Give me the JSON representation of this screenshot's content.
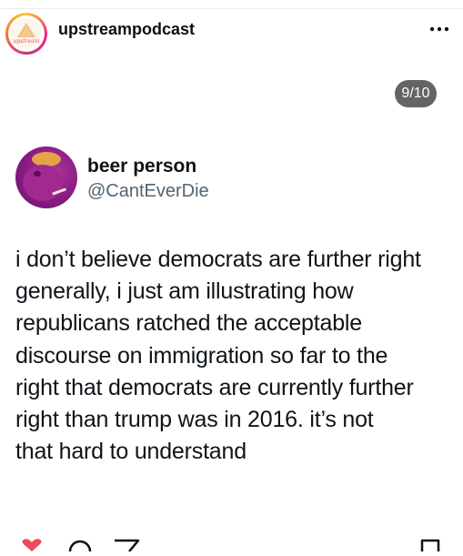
{
  "header": {
    "username": "upstreampodcast",
    "logo_text": "upstream",
    "more_icon": "more-horizontal-icon"
  },
  "carousel": {
    "counter": "9/10"
  },
  "tweet": {
    "display_name": "beer person",
    "handle": "@CantEverDie",
    "lines": [
      "i don’t believe democrats are further right",
      "generally, i just am illustrating how",
      "republicans ratched the acceptable",
      "discourse on immigration so far to the",
      "right that democrats are currently further",
      "right than trump was in 2016.  it’s not",
      "that hard to understand"
    ]
  },
  "actions": {
    "like_icon": "heart-icon",
    "comment_icon": "comment-icon",
    "share_icon": "share-icon",
    "save_icon": "bookmark-icon",
    "like_color": "#ed4956"
  }
}
